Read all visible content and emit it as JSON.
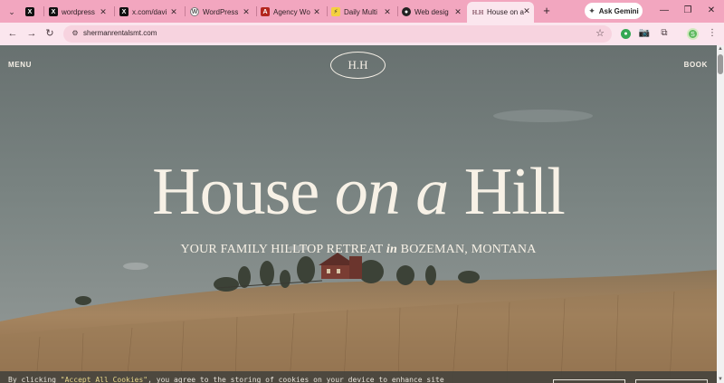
{
  "browser": {
    "tabs": [
      {
        "title": "",
        "favicon": "x-logo-icon",
        "active": false
      },
      {
        "title": "wordpress",
        "favicon": "x-logo-icon",
        "active": false
      },
      {
        "title": "x.com/davi",
        "favicon": "x-logo-icon",
        "active": false
      },
      {
        "title": "WordPress",
        "favicon": "wordpress-icon",
        "active": false
      },
      {
        "title": "Agency Wo",
        "favicon": "agency-icon",
        "active": false
      },
      {
        "title": "Daily Multi",
        "favicon": "lightning-icon",
        "active": false
      },
      {
        "title": "Web desig",
        "favicon": "github-icon",
        "active": false
      },
      {
        "title": "House on a",
        "favicon": "hh-icon",
        "active": true
      }
    ],
    "ask_gemini_label": "Ask Gemini",
    "url": "shermanrentalsmt.com"
  },
  "site": {
    "menu_label": "MENU",
    "book_label": "BOOK",
    "logo_text": "H.H",
    "title_word1": "House",
    "title_italic": "on a",
    "title_word2": "Hill",
    "subtitle_part1": "YOUR FAMILY HILLTOP RETREAT",
    "subtitle_italic": "in",
    "subtitle_part2": "BOZEMAN, MONTANA"
  },
  "cookie": {
    "text_before": "By clicking ",
    "highlight": "\"Accept All Cookies\"",
    "text_after": ", you agree to the storing of cookies on your device to enhance site"
  },
  "colors": {
    "chrome_tabbar": "#f2a6bf",
    "chrome_toolbar": "#fbe6ee",
    "hero_text": "#f7f1e6"
  }
}
